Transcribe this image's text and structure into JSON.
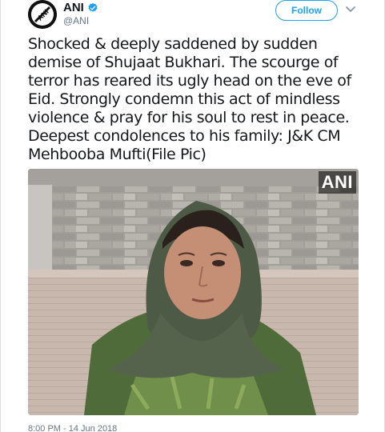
{
  "tweet": {
    "display_name": "ANI",
    "handle": "@ANI",
    "follow_label": "Follow",
    "text": "Shocked & deeply saddened by sudden\ndemise of Shujaat Bukhari. The scourge of\nterror has reared its ugly head on the eve of\nEid. Strongly condemn this act of mindless\nviolence & pray for his soul to rest in peace.\nDeepest condolences to his family: J&K CM\nMehbooba Mufti(File Pic)",
    "timestamp": "8:00 PM - 14 Jun 2018",
    "media": {
      "watermark": "ANI"
    },
    "avatar_logo_text": "ANI"
  },
  "colors": {
    "accent": "#1da1f2",
    "text": "#14171a",
    "secondary": "#657786"
  },
  "icons": [
    "ani-logo-icon",
    "verified-badge-icon",
    "chevron-down-icon"
  ]
}
